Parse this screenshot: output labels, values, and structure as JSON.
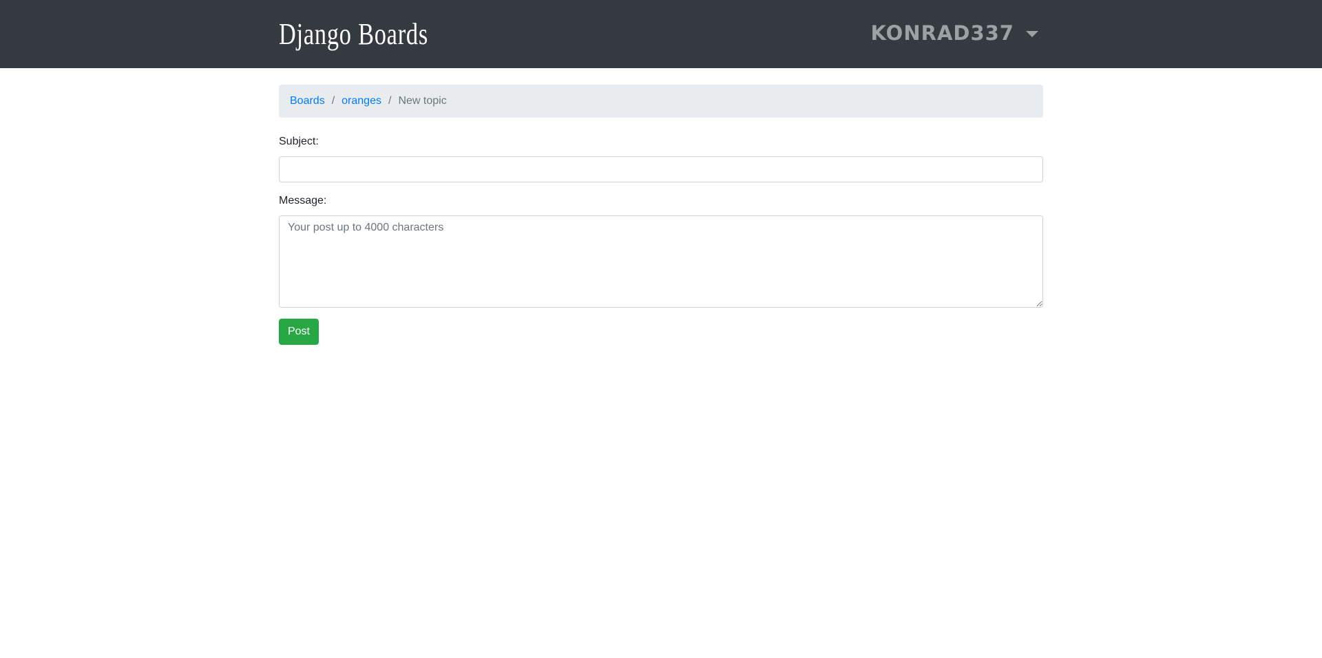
{
  "navbar": {
    "brand": "Django Boards",
    "username": "KONRAD337",
    "user_menu_icon": "caret-down-icon"
  },
  "breadcrumb": {
    "items": [
      {
        "label": "Boards"
      },
      {
        "label": "oranges"
      }
    ],
    "separator": "/",
    "active": "New topic"
  },
  "form": {
    "subject_label": "Subject:",
    "subject_value": "",
    "message_label": "Message:",
    "message_placeholder": "Your post up to 4000 characters",
    "submit_label": "Post"
  },
  "colors": {
    "navbar_bg": "#343a40",
    "link": "#007bff",
    "submit_bg": "#28a745"
  }
}
